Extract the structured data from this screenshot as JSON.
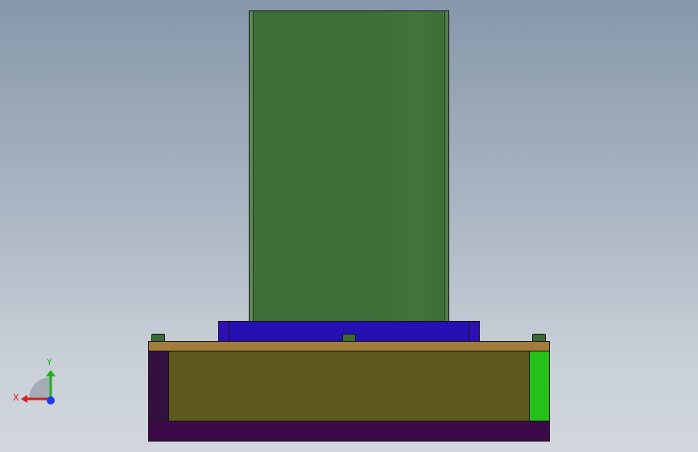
{
  "viewport": {
    "background_top": "#8797aa",
    "background_bottom": "#d2d7dd"
  },
  "model": {
    "parts": [
      {
        "name": "column",
        "color": "#3d6e37"
      },
      {
        "name": "flange",
        "color": "#2e0fb6"
      },
      {
        "name": "plate",
        "color": "#a17c3b"
      },
      {
        "name": "base-body",
        "color": "#5e5a1e"
      },
      {
        "name": "base-left-block",
        "color": "#33103f"
      },
      {
        "name": "base-right-block",
        "color": "#25c018"
      },
      {
        "name": "base-bottom",
        "color": "#3d0a49"
      },
      {
        "name": "bolt",
        "color": "#3a6b35"
      }
    ]
  },
  "triad": {
    "x_label": "X",
    "y_label": "Y",
    "x_color": "#d42020",
    "y_color": "#1fae1f",
    "z_color": "#1f3fe0",
    "icons": [
      "coordinate-triad-icon"
    ]
  }
}
